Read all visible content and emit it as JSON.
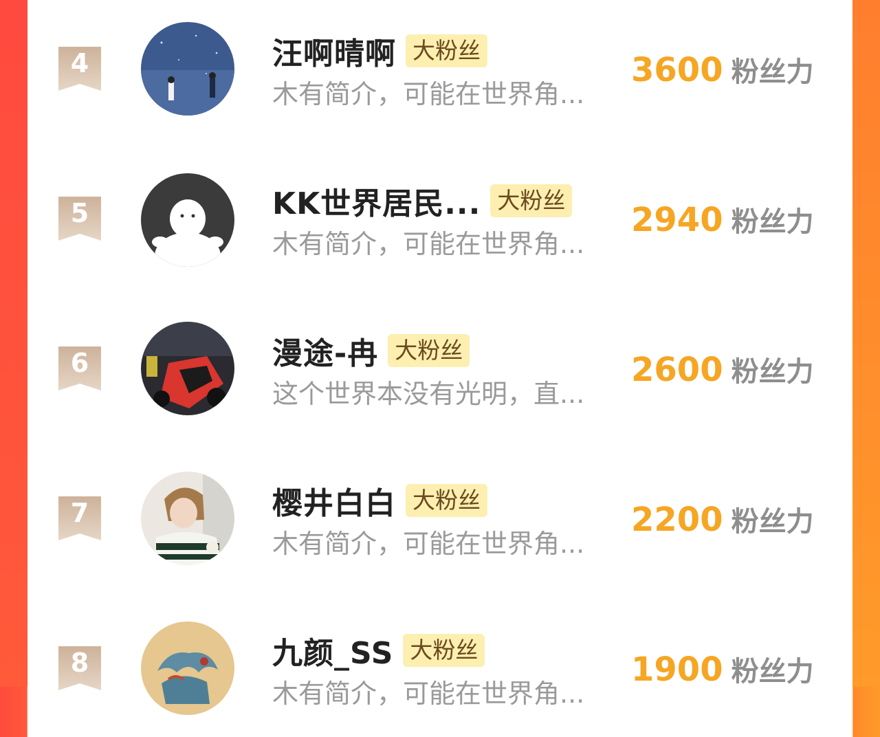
{
  "colors": {
    "left_band": "#ff4a3f",
    "right_band": "#ff9b2a",
    "rank_badge": "#d8c1ad",
    "fan_badge_bg": "#fcefb0",
    "power_value": "#f6a623"
  },
  "rows": [
    {
      "rank": "4",
      "name": "汪啊晴啊",
      "badge": "大粉丝",
      "bio": "木有简介，可能在世界角...",
      "power": "3600",
      "unit": "粉丝力",
      "avatar": "night-sky-couple-avatar"
    },
    {
      "rank": "5",
      "name": "KK世界居民...",
      "badge": "大粉丝",
      "bio": "木有简介，可能在世界角...",
      "power": "2940",
      "unit": "粉丝力",
      "avatar": "default-ghost-avatar"
    },
    {
      "rank": "6",
      "name": "漫途-冉",
      "badge": "大粉丝",
      "bio": "这个世界本没有光明，直...",
      "power": "2600",
      "unit": "粉丝力",
      "avatar": "motorcycle-avatar"
    },
    {
      "rank": "7",
      "name": "樱井白白",
      "badge": "大粉丝",
      "bio": "木有简介，可能在世界角...",
      "power": "2200",
      "unit": "粉丝力",
      "avatar": "person-sweater-avatar"
    },
    {
      "rank": "8",
      "name": "九颜_SS",
      "badge": "大粉丝",
      "bio": "木有简介，可能在世界角...",
      "power": "1900",
      "unit": "粉丝力",
      "avatar": "qilin-artwork-avatar"
    }
  ]
}
